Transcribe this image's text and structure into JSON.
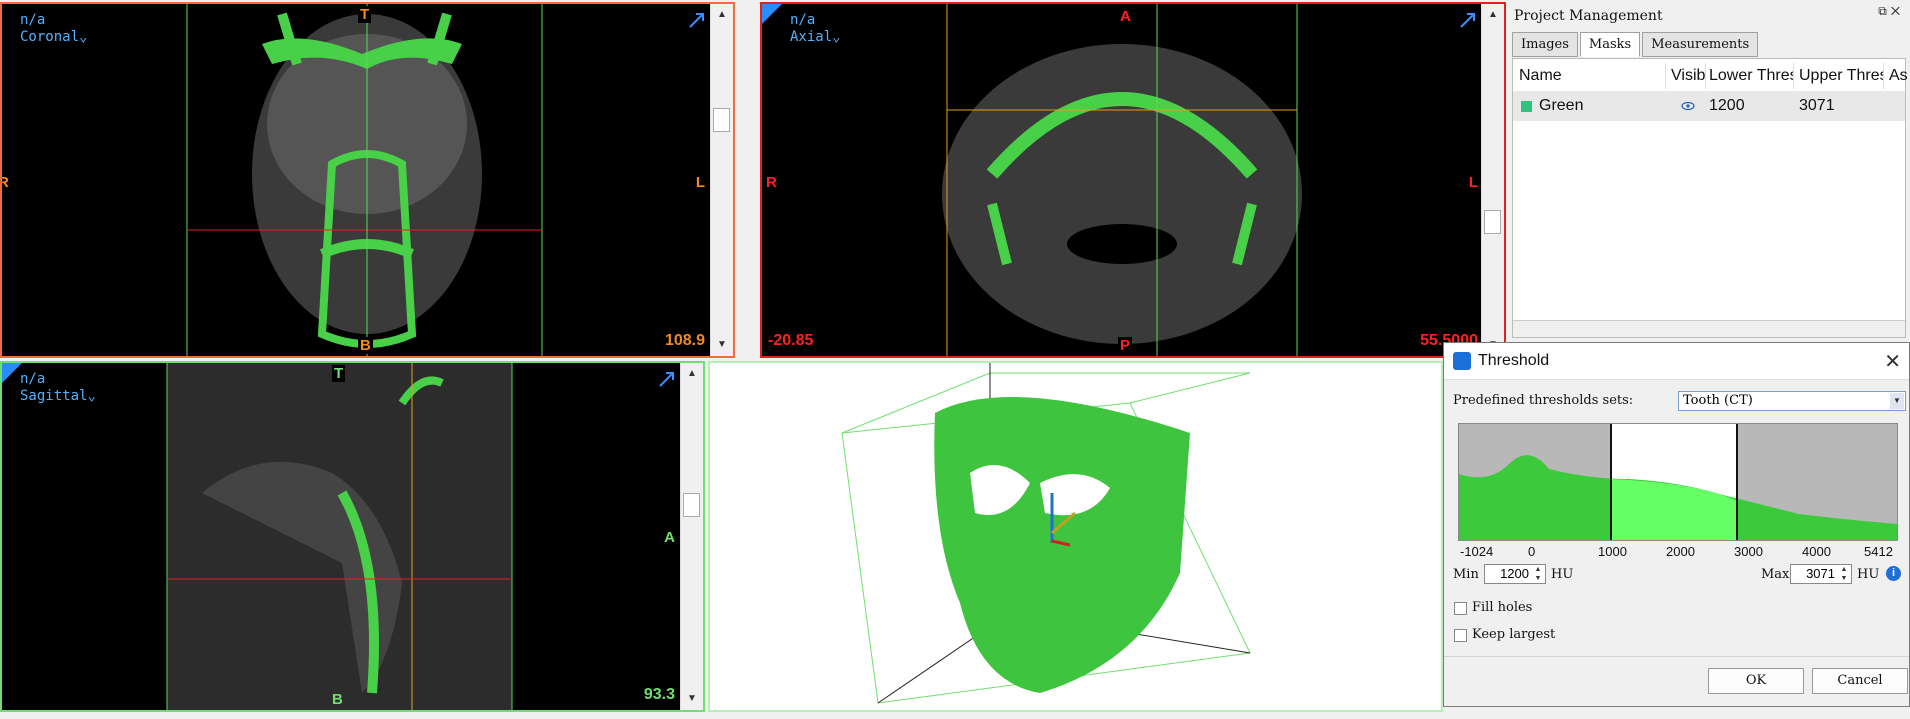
{
  "views": {
    "coronal": {
      "line1": "n/a",
      "plane": "Coronal",
      "top": "T",
      "bottom": "B",
      "left": "R",
      "right": "L",
      "value": "108.9"
    },
    "axial": {
      "line1": "n/a",
      "plane": "Axial",
      "top": "A",
      "bottom": "P",
      "left": "R",
      "right": "L",
      "value_left": "-20.85",
      "value_right": "55.5000"
    },
    "sagittal": {
      "line1": "n/a",
      "plane": "Sagittal",
      "top": "T",
      "bottom": "B",
      "right": "A",
      "value": "93.3"
    }
  },
  "project_panel": {
    "title": "Project Management",
    "tabs": [
      "Images",
      "Masks",
      "Measurements"
    ],
    "active_tab": "Masks",
    "columns": [
      "Name",
      "Visible",
      "Lower Threshold",
      "Upper Threshold",
      "As"
    ],
    "rows": [
      {
        "color": "#2ec27e",
        "name": "Green",
        "lower": "1200",
        "upper": "3071"
      }
    ]
  },
  "threshold_dialog": {
    "title": "Threshold",
    "predefined_label": "Predefined thresholds sets:",
    "predefined_value": "Tooth (CT)",
    "axis_ticks": [
      "-1024",
      "0",
      "1000",
      "2000",
      "3000",
      "4000",
      "5412"
    ],
    "min_label": "Min",
    "min_value": "1200",
    "max_label": "Max",
    "max_value": "3071",
    "unit": "HU",
    "fill_holes": "Fill holes",
    "keep_largest": "Keep largest",
    "ok": "OK",
    "cancel": "Cancel"
  },
  "colors": {
    "coronal_border": "#f26b3a",
    "axial_border": "#e0201a",
    "sagittal_border": "#6fe06f",
    "mask": "#4fdc4f",
    "accent": "#1d6fd8"
  }
}
